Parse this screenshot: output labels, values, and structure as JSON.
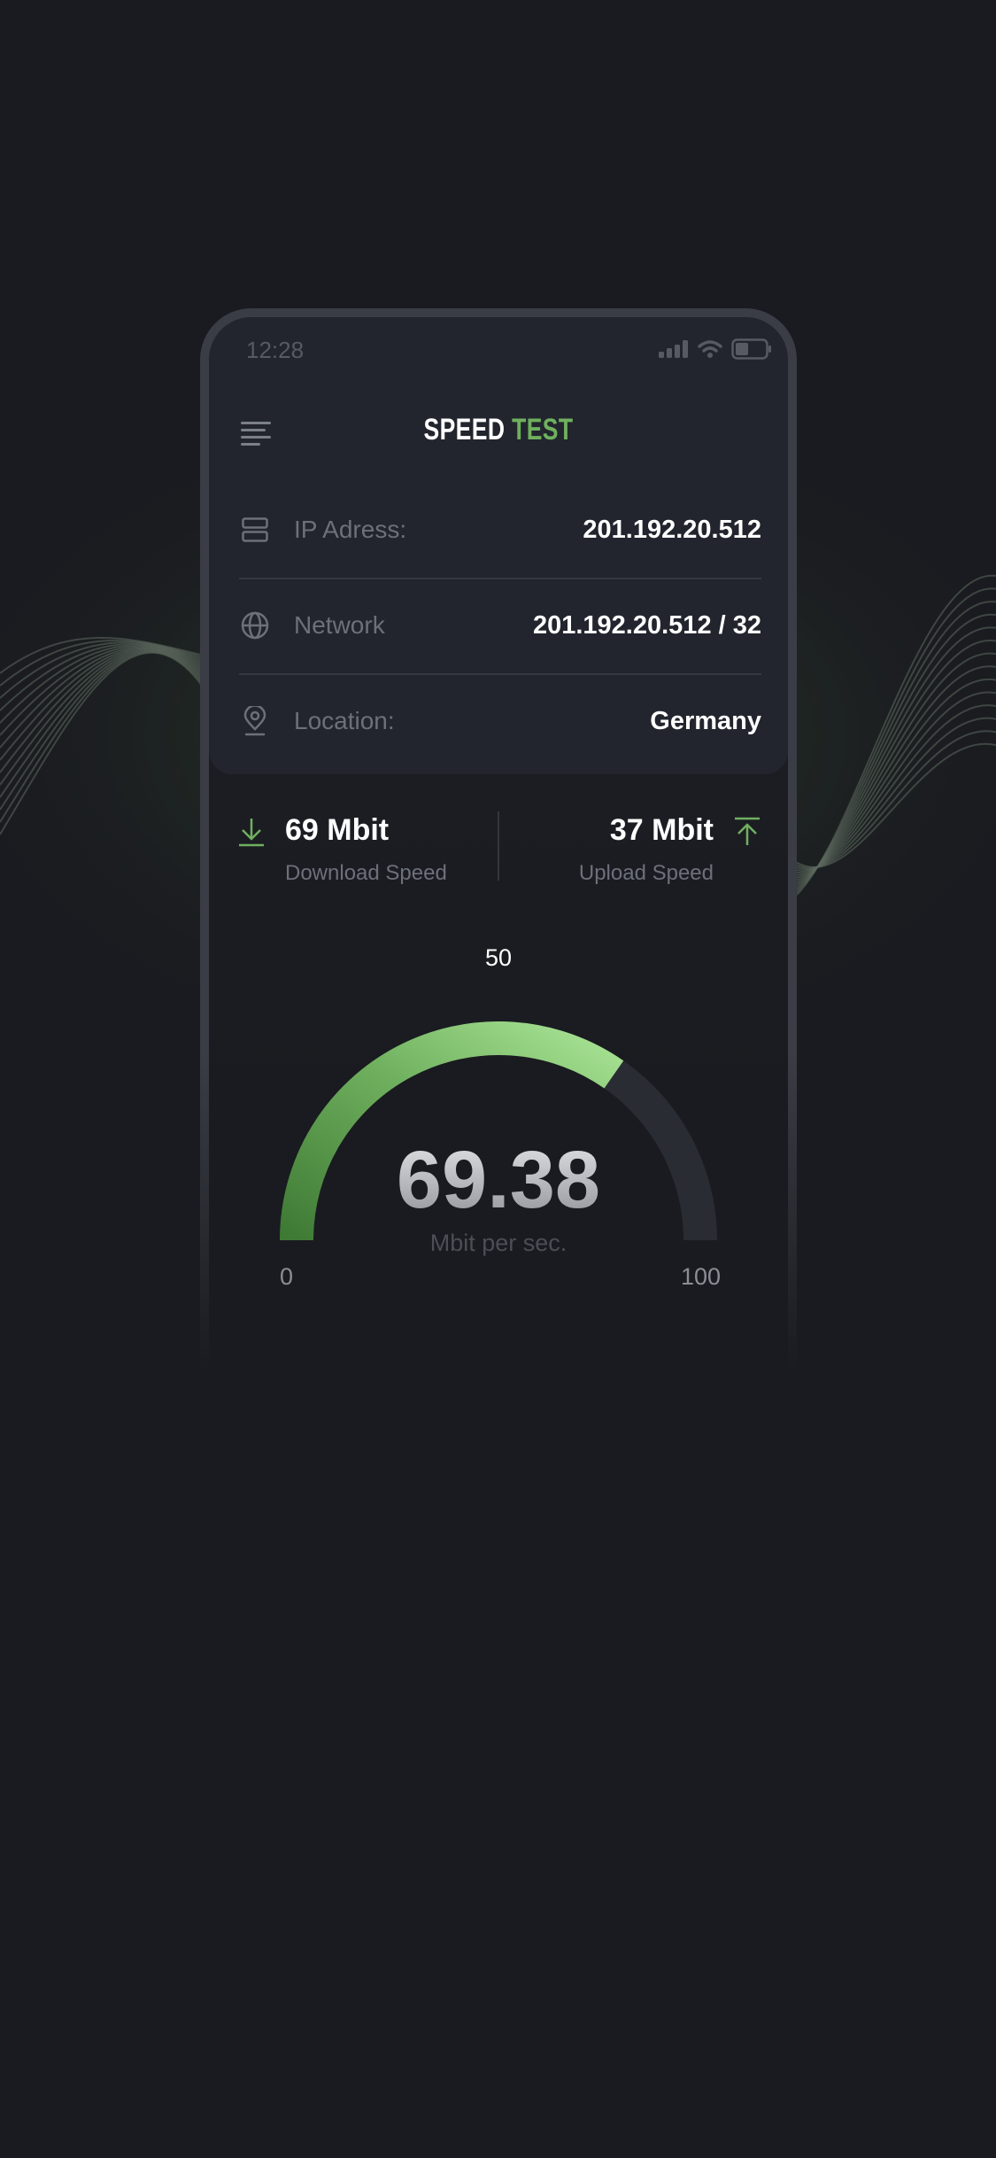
{
  "status": {
    "time": "12:28"
  },
  "header": {
    "title_part1": "SPEED",
    "title_part2": "TEST"
  },
  "info": [
    {
      "icon": "server-icon",
      "label": "IP Adress:",
      "value": "201.192.20.512"
    },
    {
      "icon": "globe-icon",
      "label": "Network",
      "value": "201.192.20.512 / 32"
    },
    {
      "icon": "location-pin-icon",
      "label": "Location:",
      "value": "Germany"
    }
  ],
  "download": {
    "value": "69 Mbit",
    "label": "Download Speed"
  },
  "upload": {
    "value": "37 Mbit",
    "label": "Upload Speed"
  },
  "gauge": {
    "current": "69.38",
    "current_number": 69.38,
    "unit": "Mbit per sec.",
    "min": "0",
    "mid": "50",
    "max": "100"
  },
  "colors": {
    "accent": "#6fb05e",
    "background": "#1a1b20",
    "card": "#22252d"
  }
}
